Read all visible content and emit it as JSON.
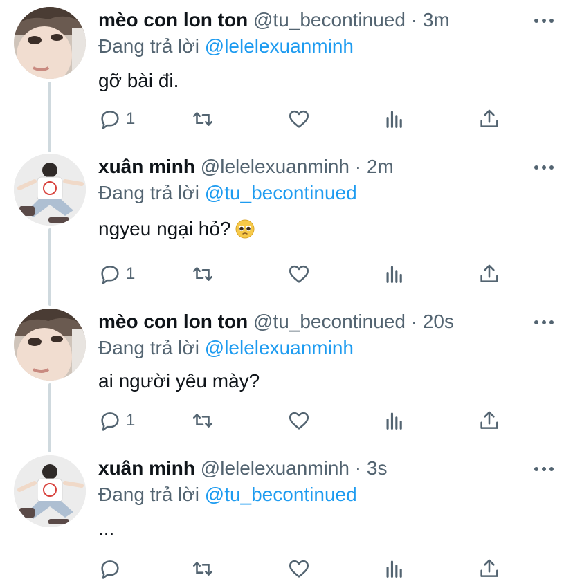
{
  "colors": {
    "link": "#1d9bf0",
    "secondary": "#536471",
    "thread": "#cfd9de"
  },
  "icons": {
    "reply": "speech-bubble-icon",
    "retweet": "retweet-icon",
    "like": "heart-icon",
    "analytics": "bar-chart-icon",
    "share": "share-icon",
    "more": "more-dots-icon",
    "emoji": "pleading-face-emoji"
  },
  "tweets": [
    {
      "name": "mèo con lon ton",
      "handle": "@tu_becontinued",
      "separator": "·",
      "time": "3m",
      "reply_prefix": "Đang trả lời",
      "reply_to": "@lelelexuanminh",
      "text": "gỡ bài đi.",
      "reply_count": "1",
      "avatar": "cat-avatar"
    },
    {
      "name": "xuân minh",
      "handle": "@lelelexuanminh",
      "separator": "·",
      "time": "2m",
      "reply_prefix": "Đang trả lời",
      "reply_to": "@tu_becontinued",
      "text": "ngyeu ngại hỏ?",
      "reply_count": "1",
      "avatar": "boy-avatar"
    },
    {
      "name": "mèo con lon ton",
      "handle": "@tu_becontinued",
      "separator": "·",
      "time": "20s",
      "reply_prefix": "Đang trả lời",
      "reply_to": "@lelelexuanminh",
      "text": "ai người yêu mày?",
      "reply_count": "1",
      "avatar": "cat-avatar"
    },
    {
      "name": "xuân minh",
      "handle": "@lelelexuanminh",
      "separator": "·",
      "time": "3s",
      "reply_prefix": "Đang trả lời",
      "reply_to": "@tu_becontinued",
      "text": "...",
      "reply_count": "",
      "avatar": "boy-avatar"
    }
  ]
}
